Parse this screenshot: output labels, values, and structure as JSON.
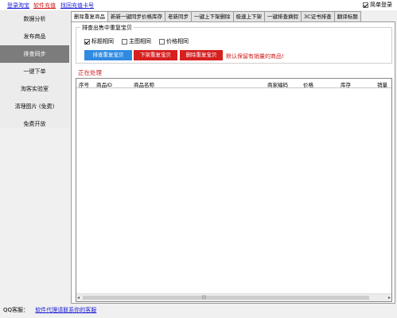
{
  "topbar": {
    "links": [
      "登录淘宝",
      "软件充值",
      "找回充值卡号"
    ],
    "quick_login": "简单登录",
    "quick_login_checked": true
  },
  "sidebar": {
    "items": [
      "数据分析",
      "发布商品",
      "排查同步",
      "一键下单",
      "淘客实验室",
      "清理图片 (免费)",
      "免费开放"
    ],
    "active_index": 2
  },
  "tabs": {
    "items": [
      "删除重复商品",
      "新新一键同步价格库存",
      "老新同步",
      "一键上下架删除",
      "极速上下架",
      "一键排查摘假",
      "3C证书排查",
      "翻译标题"
    ],
    "active_index": 0
  },
  "dedupe": {
    "group_title": "排查出售中重复宝贝",
    "options": [
      {
        "label": "标题相同",
        "checked": true
      },
      {
        "label": "主图相同",
        "checked": false
      },
      {
        "label": "价格相同",
        "checked": false
      }
    ],
    "btn_check": "排查重复宝贝",
    "btn_unlist": "下架重复宝贝",
    "btn_delete": "删除重复宝贝",
    "hint": "默认保留有销量的商品!",
    "status": "正在处理"
  },
  "table": {
    "columns": [
      "序号",
      "商品ID",
      "商品名称",
      "商家编码",
      "价格",
      "库存",
      "销量"
    ]
  },
  "footer": {
    "label": "QQ客服：",
    "link": "软件代理请联系你的客服"
  },
  "colors": {
    "link": "#1a1ad8",
    "accent_red": "#d61f1f",
    "accent_blue": "#2f8ae0",
    "sidebar_active": "#7c7c7c"
  }
}
